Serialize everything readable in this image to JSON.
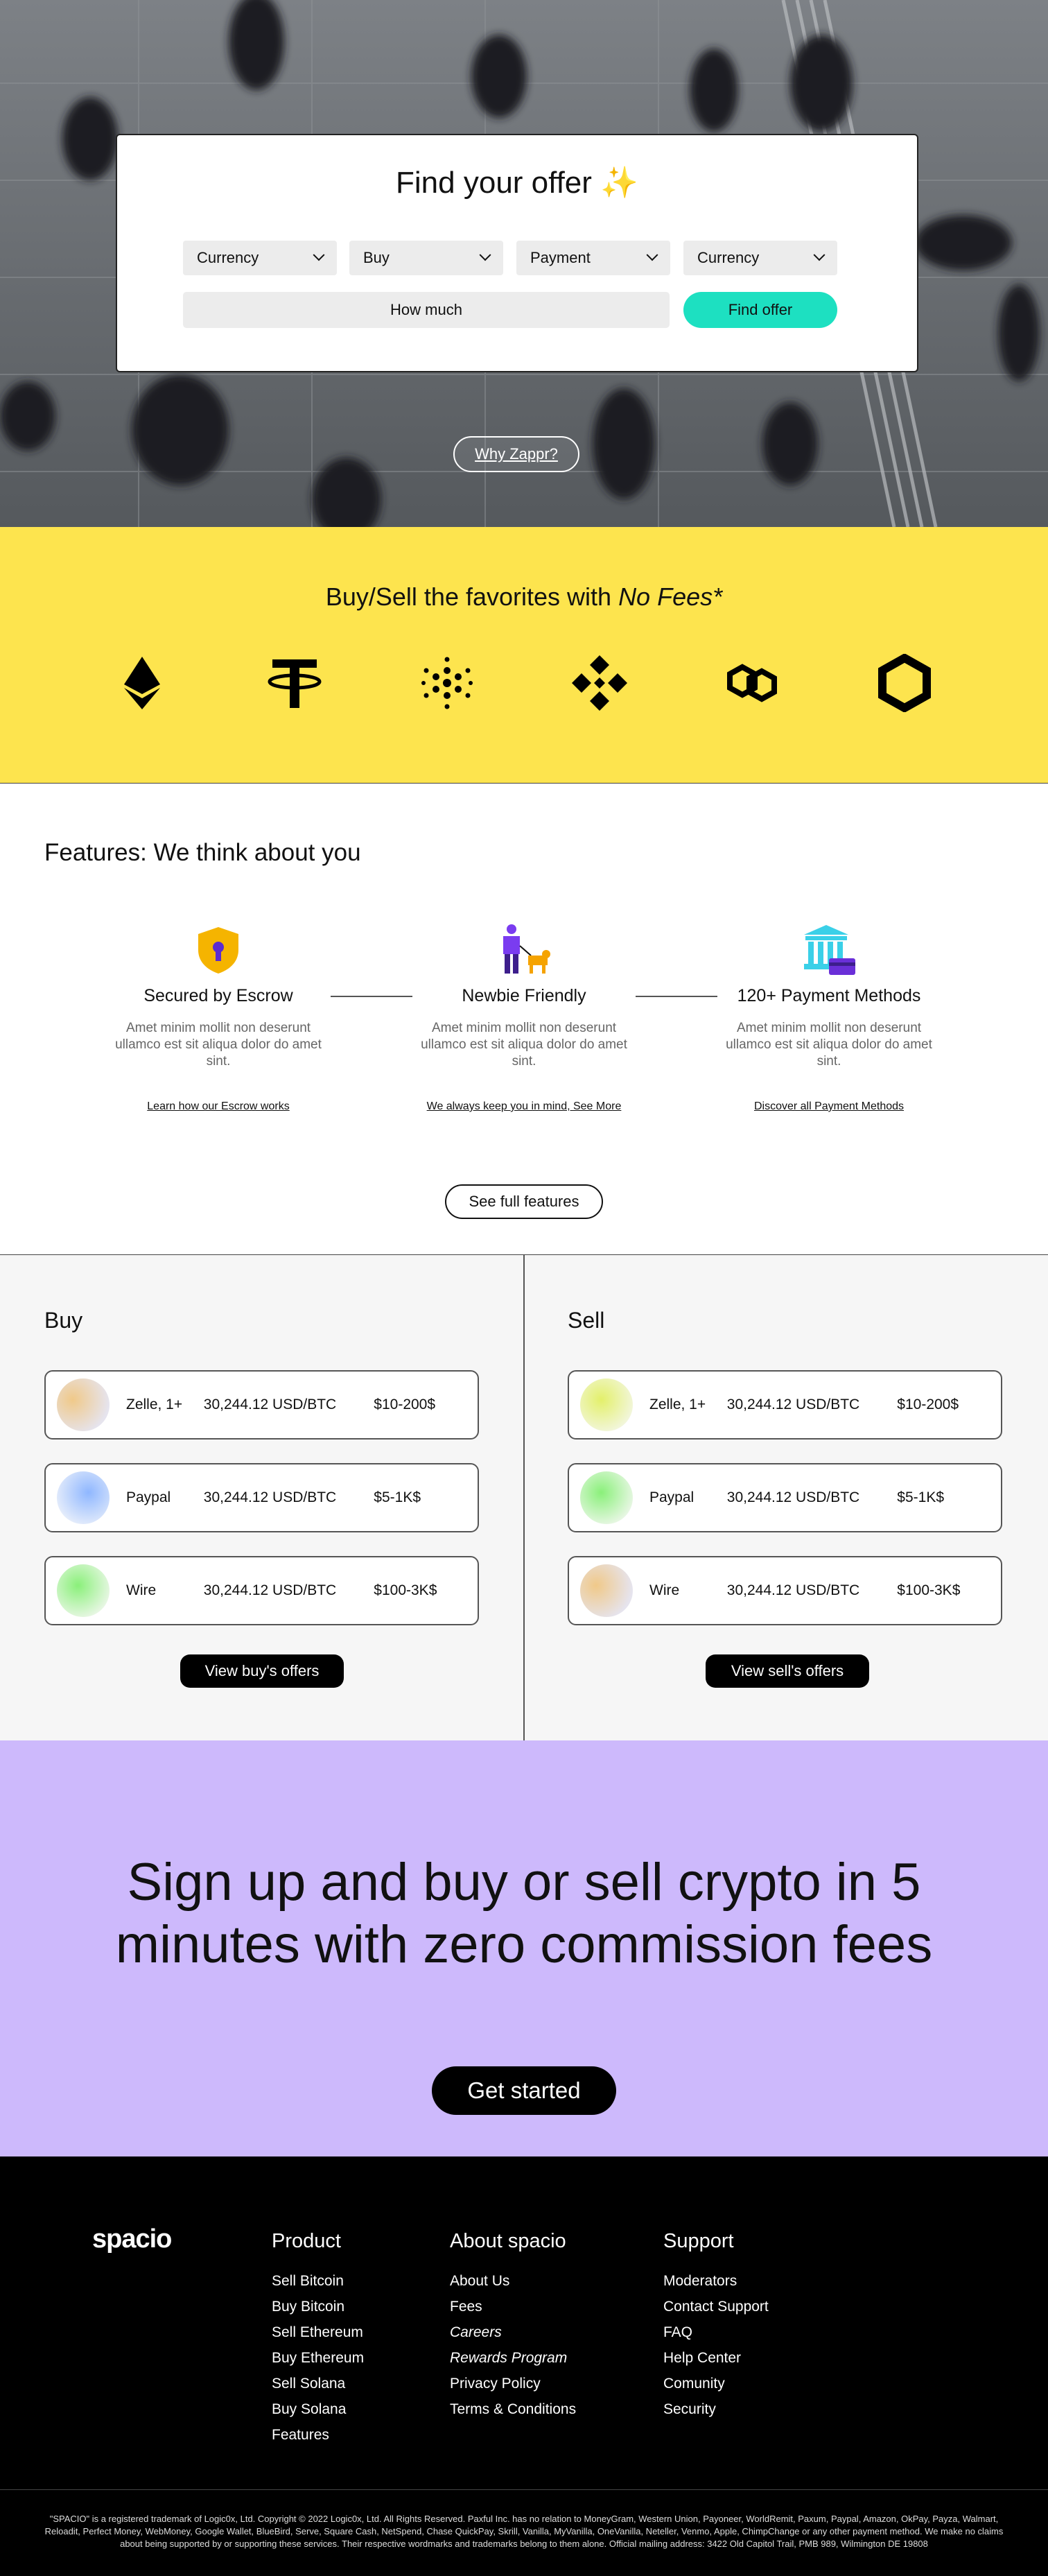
{
  "hero": {
    "title": "Find your offer",
    "title_emoji": "✨",
    "selects": [
      "Currency",
      "Buy",
      "Payment",
      "Currency"
    ],
    "amount_placeholder": "How much",
    "find_button": "Find offer",
    "why_button": "Why Zappr?"
  },
  "coins": {
    "title_plain": "Buy/Sell the favorites with ",
    "title_italic": "No Fees*",
    "icons": [
      "ethereum-icon",
      "tether-icon",
      "cardano-icon",
      "binance-icon",
      "polygon-icon",
      "chainlink-icon"
    ]
  },
  "features": {
    "heading": "Features: We think about you",
    "items": [
      {
        "icon": "shield-lock-icon",
        "title": "Secured by Escrow",
        "desc": "Amet minim mollit non deserunt ullamco est sit aliqua dolor do amet sint.",
        "link": "Learn how our Escrow works"
      },
      {
        "icon": "person-with-dog-icon",
        "title": "Newbie Friendly",
        "desc": "Amet minim mollit non deserunt ullamco est sit aliqua dolor do amet sint.",
        "link": "We always keep you in mind, See More"
      },
      {
        "icon": "bank-card-icon",
        "title": "120+ Payment Methods",
        "desc": "Amet minim mollit non deserunt ullamco est sit aliqua dolor do amet sint.",
        "link": "Discover all Payment Methods"
      }
    ],
    "full_button": "See full features"
  },
  "buy": {
    "heading": "Buy",
    "offers": [
      {
        "method": "Zelle, 1+",
        "price": "30,244.12 USD/BTC",
        "range": "$10-200$"
      },
      {
        "method": "Paypal",
        "price": "30,244.12 USD/BTC",
        "range": "$5-1K$"
      },
      {
        "method": "Wire",
        "price": "30,244.12 USD/BTC",
        "range": "$100-3K$"
      }
    ],
    "button": "View buy's offers"
  },
  "sell": {
    "heading": "Sell",
    "offers": [
      {
        "method": "Zelle, 1+",
        "price": "30,244.12 USD/BTC",
        "range": "$10-200$"
      },
      {
        "method": "Paypal",
        "price": "30,244.12 USD/BTC",
        "range": "$5-1K$"
      },
      {
        "method": "Wire",
        "price": "30,244.12 USD/BTC",
        "range": "$100-3K$"
      }
    ],
    "button": "View sell's offers"
  },
  "cta": {
    "headline": "Sign up and buy or sell crypto in 5 minutes with zero commission fees",
    "button": "Get started"
  },
  "footer": {
    "logo": "spacio",
    "product": {
      "heading": "Product",
      "links": [
        "Sell Bitcoin",
        "Buy Bitcoin",
        "Sell Ethereum",
        "Buy Ethereum",
        "Sell Solana",
        "Buy Solana",
        "Features"
      ]
    },
    "about": {
      "heading": "About spacio",
      "links": [
        "About Us",
        "Fees",
        "Careers",
        "Rewards Program",
        "Privacy Policy",
        "Terms & Conditions"
      ]
    },
    "support": {
      "heading": "Support",
      "links": [
        "Moderators",
        "Contact Support",
        "FAQ",
        "Help Center",
        "Comunity",
        "Security"
      ]
    },
    "legal": "\"SPACIO\" is a registered trademark of Logic0x, Ltd. Copyright © 2022 Logic0x, Ltd. All Rights Reserved. Paxful Inc. has no relation to MoneyGram, Western Union, Payoneer, WorldRemit, Paxum, Paypal, Amazon, OkPay, Payza, Walmart, Reloadit, Perfect Money, WebMoney, Google Wallet, BlueBird, Serve, Square Cash, NetSpend, Chase QuickPay, Skrill, Vanilla, MyVanilla, OneVanilla, Neteller, Venmo, Apple, ChimpChange or any other payment method. We make no claims about being supported by or supporting these services. Their respective wordmarks and trademarks belong to them alone. Official mailing address: 3422 Old Capitol Trail, PMB 989, Wilmington DE 19808"
  },
  "colors": {
    "accent_teal": "#1de0c1",
    "coins_yellow": "#fde44e",
    "cta_purple": "#cdb9fc",
    "footer_black": "#000000"
  }
}
